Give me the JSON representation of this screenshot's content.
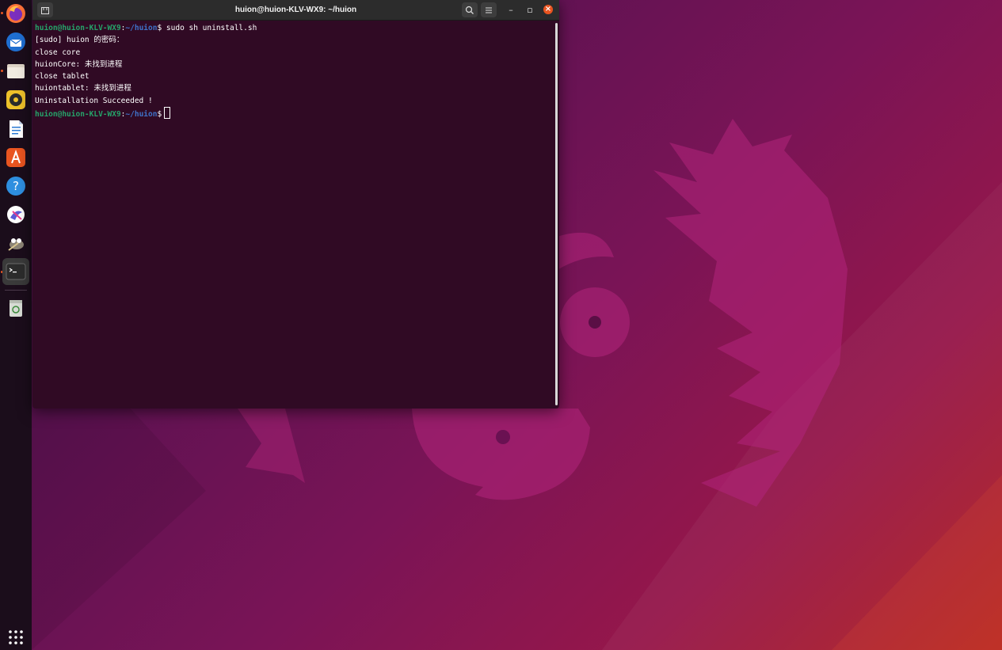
{
  "window": {
    "title": "huion@huion-KLV-WX9: ~/huion"
  },
  "titlebar": {
    "new_tab_icon": "new-tab-icon",
    "search_icon": "search-icon",
    "menu_icon": "hamburger-menu-icon",
    "minimize_glyph": "–",
    "maximize_glyph": "▫",
    "close_glyph": "×"
  },
  "terminal": {
    "prompt": {
      "user_host": "huion@huion-KLV-WX9",
      "colon": ":",
      "path": "~/huion",
      "dollar": "$"
    },
    "first_command": " sudo sh uninstall.sh",
    "output_lines": [
      "[sudo] huion 的密码：",
      "close core",
      "huionCore: 未找到进程",
      "close tablet",
      "huiontablet: 未找到进程",
      "Uninstallation Succeeded !"
    ]
  },
  "dock": {
    "items": [
      {
        "icon": "firefox-icon",
        "running": true
      },
      {
        "icon": "thunderbird-icon",
        "running": false
      },
      {
        "icon": "files-icon",
        "running": true
      },
      {
        "icon": "rhythmbox-icon",
        "running": false
      },
      {
        "icon": "libreoffice-writer-icon",
        "running": false
      },
      {
        "icon": "app-center-icon",
        "running": false
      },
      {
        "icon": "help-icon",
        "running": false
      },
      {
        "icon": "huion-tablet-icon",
        "running": false
      },
      {
        "icon": "gimp-icon",
        "running": false
      },
      {
        "icon": "terminal-icon",
        "running": true
      },
      {
        "icon": "trash-icon",
        "running": false
      }
    ],
    "show_apps_icon": "show-apps-grid-icon"
  },
  "colors": {
    "terminal_bg": "#300a24",
    "prompt_user": "#26a269",
    "prompt_path": "#3f72c8",
    "accent": "#e95420"
  }
}
